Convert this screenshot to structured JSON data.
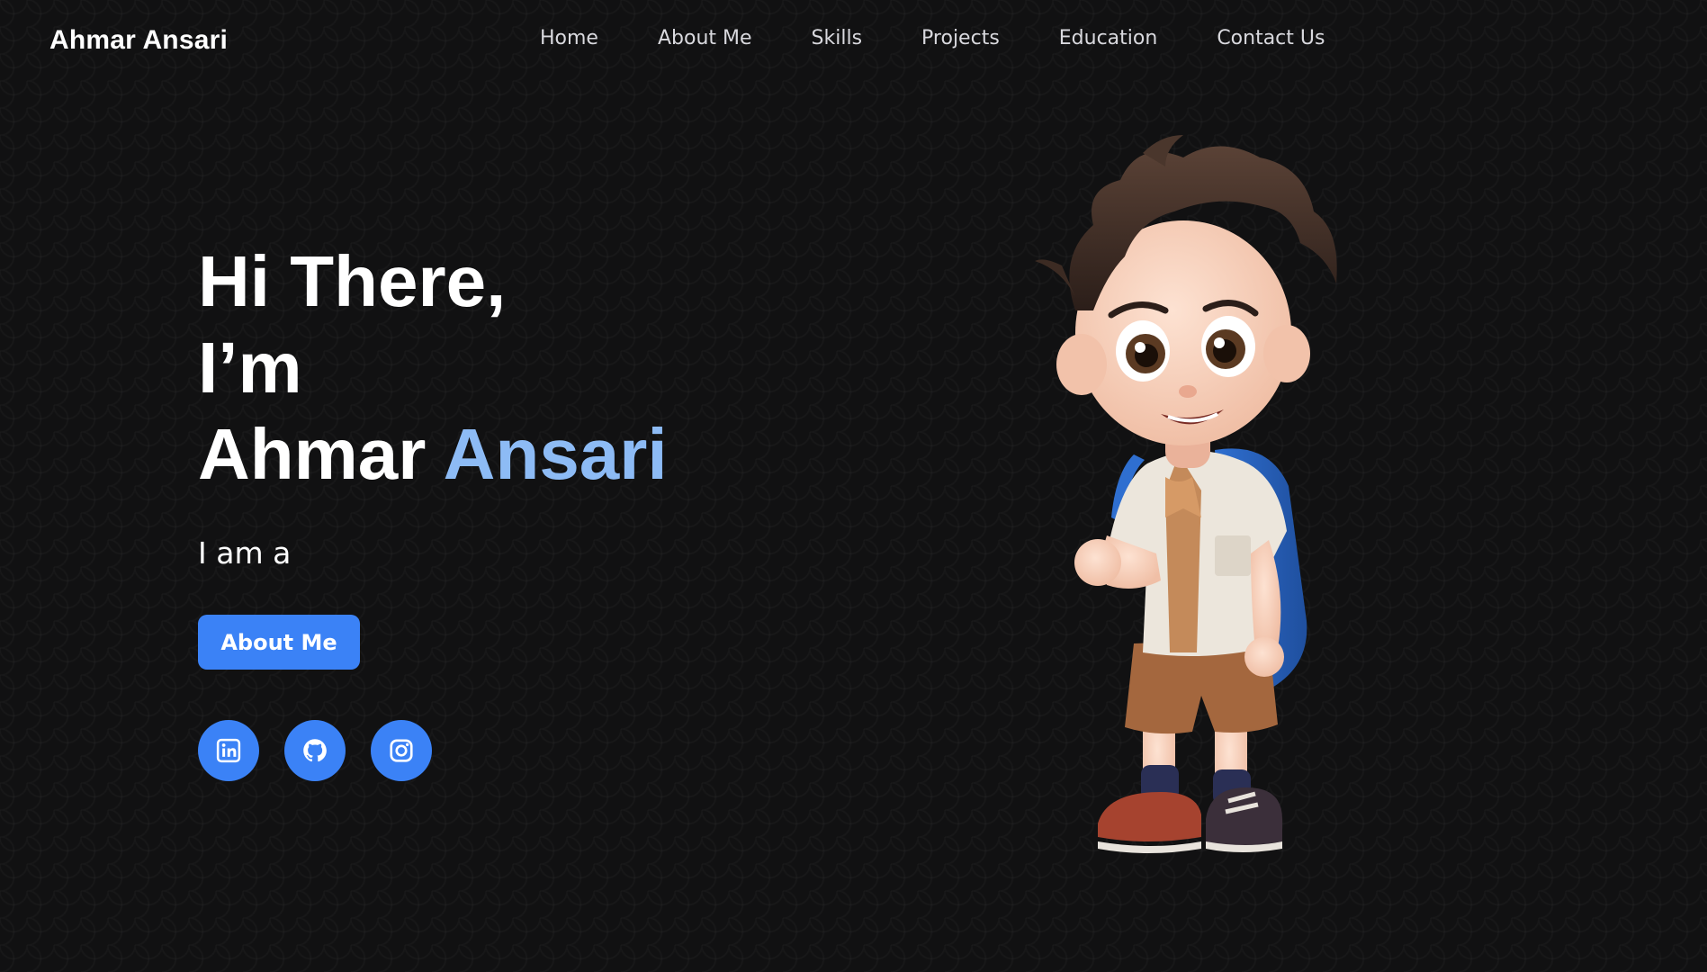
{
  "header": {
    "brand": "Ahmar Ansari",
    "nav": [
      "Home",
      "About Me",
      "Skills",
      "Projects",
      "Education",
      "Contact Us"
    ]
  },
  "hero": {
    "line1": "Hi There,",
    "line2": "I’m",
    "first_name": "Ahmar",
    "last_name": "Ansari",
    "tagline": "I am a",
    "button_label": "About Me"
  },
  "socials": [
    {
      "icon": "linkedin-icon"
    },
    {
      "icon": "github-icon"
    },
    {
      "icon": "instagram-icon"
    }
  ],
  "colors": {
    "background": "#111112",
    "accent": "#3b82f6",
    "name_highlight": "#8dbbf5",
    "text": "#ffffff"
  }
}
